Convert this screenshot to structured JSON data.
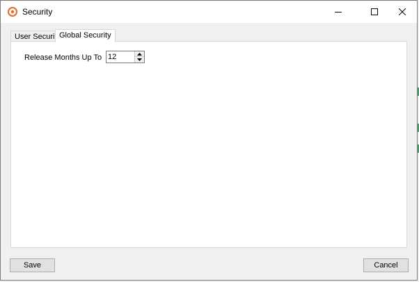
{
  "window": {
    "title": "Security",
    "accent_color": "#e8672a"
  },
  "title_controls": {
    "minimize_icon": "minimize-icon",
    "maximize_icon": "maximize-icon",
    "close_icon": "close-icon"
  },
  "tabs": [
    {
      "label": "User Security",
      "active": false
    },
    {
      "label": "Global Security",
      "active": true
    }
  ],
  "global_security": {
    "release_months_label": "Release Months Up To",
    "release_months_value": "12"
  },
  "footer": {
    "save_label": "Save",
    "cancel_label": "Cancel"
  }
}
